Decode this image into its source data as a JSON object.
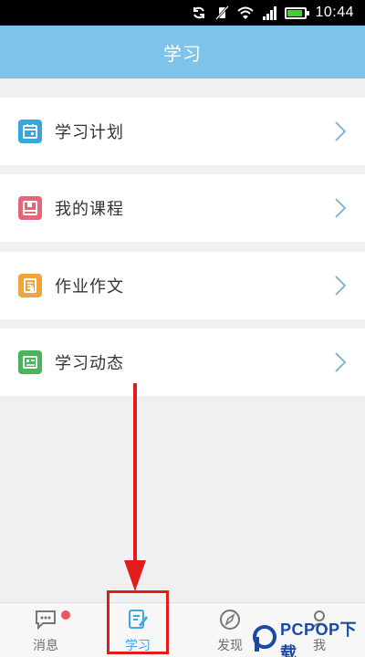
{
  "status_bar": {
    "time": "10:44",
    "icons": [
      "sync-icon",
      "vibrate-off-icon",
      "wifi-icon",
      "signal-icon",
      "battery-icon"
    ],
    "battery_color": "#3cd32a"
  },
  "header": {
    "title": "学习",
    "background": "#7fc3eb"
  },
  "menu": {
    "items": [
      {
        "label": "学习计划",
        "icon": "calendar-icon",
        "color": "#39a5dd"
      },
      {
        "label": "我的课程",
        "icon": "course-book-icon",
        "color": "#e46777"
      },
      {
        "label": "作业作文",
        "icon": "homework-icon",
        "color": "#f0a43a"
      },
      {
        "label": "学习动态",
        "icon": "activity-board-icon",
        "color": "#4db35a"
      }
    ]
  },
  "tabbar": {
    "tabs": [
      {
        "label": "消息",
        "icon": "message-icon",
        "badge": true
      },
      {
        "label": "学习",
        "icon": "study-edit-icon",
        "active": true
      },
      {
        "label": "发现",
        "icon": "compass-icon"
      },
      {
        "label": "我",
        "icon": "person-icon"
      }
    ],
    "active_color": "#3ea5e6"
  },
  "annotation": {
    "color": "#e21b1b"
  },
  "watermark": {
    "text": "PCPOP下载"
  }
}
